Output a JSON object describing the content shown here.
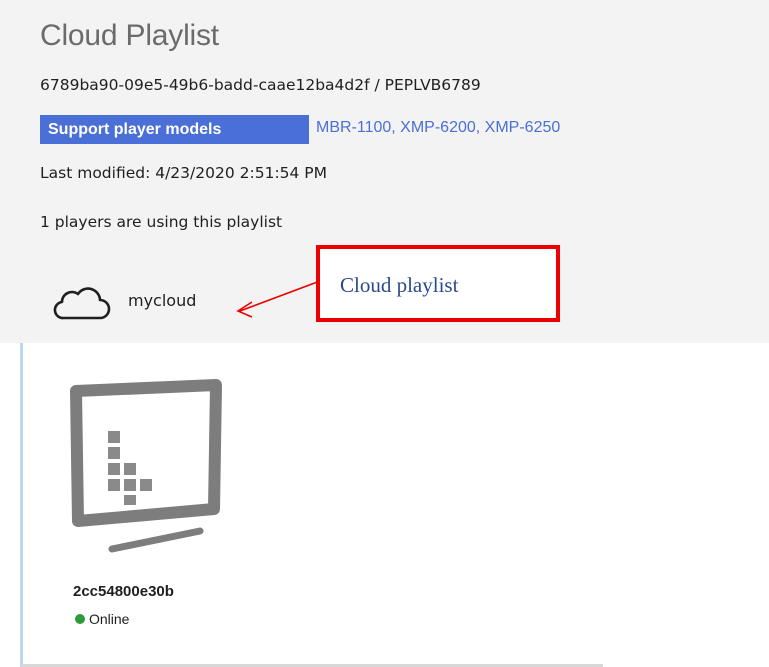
{
  "playlist": {
    "title": "Cloud Playlist",
    "id_line": "6789ba90-09e5-49b6-badd-caae12ba4d2f / PEPLVB6789",
    "support_label": "Support player models",
    "models": "MBR-1100, XMP-6200, XMP-6250",
    "last_modified": "Last modified: 4/23/2020 2:51:54 PM",
    "players_using": "1 players are using this playlist",
    "cloud_name": "mycloud"
  },
  "annotation": {
    "callout_text": "Cloud playlist",
    "box_color": "#ee0000",
    "text_color": "#2c4a8a"
  },
  "player": {
    "id": "2cc54800e30b",
    "status": "Online",
    "status_color": "#2f9a3a",
    "icon": "tv-monitor-icon"
  },
  "colors": {
    "accent": "#4a6fd6",
    "panel_bg": "#f3f3f3"
  }
}
